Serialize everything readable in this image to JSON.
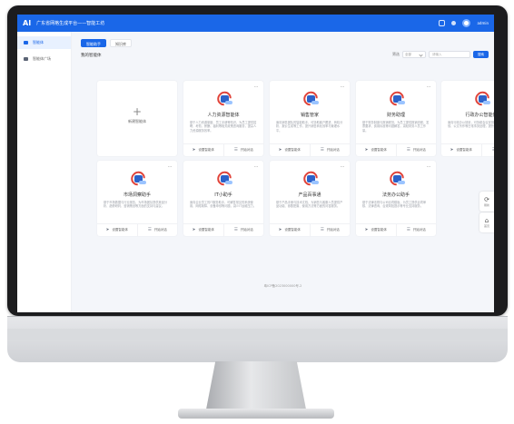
{
  "header": {
    "logo": "AI",
    "title": "广东省网格生成平台——智能工坊",
    "user": "admin"
  },
  "sidebar": {
    "items": [
      {
        "label": "智能体",
        "active": true
      },
      {
        "label": "智能体广场",
        "active": false
      }
    ]
  },
  "main": {
    "tabs": [
      {
        "label": "智能助手",
        "active": true
      },
      {
        "label": "知识库",
        "active": false
      }
    ],
    "section_title": "我的智能体",
    "filter_label": "筛选",
    "filter_value": "全部",
    "search_placeholder": "请输入",
    "search_button": "搜索",
    "new_card_label": "新建智能体",
    "footer_text": "粤ICP备2023000000号-2"
  },
  "cards": [
    {
      "name": "人力资源智能体",
      "desc": "基于人力资源制度、员工手册等知识，为员工提供招聘、考勤、薪酬、福利等相关政策咨询服务，提高人力资源服务效率。",
      "action1": "设置智能体",
      "action2": "开始对话"
    },
    {
      "name": "销售管家",
      "desc": "面向销售团队的智能助手，可协助客户跟进、商机分析、报价生成等工作，提升销售转化效率与管理水平。",
      "action1": "设置智能体",
      "action2": "开始对话"
    },
    {
      "name": "财务助理",
      "desc": "基于财务制度与报销规范，为员工提供报销流程、发票要求、费用标准等问题解答，减轻财务人员工作量。",
      "action1": "设置智能体",
      "action2": "开始对话"
    },
    {
      "name": "行政办公智能体",
      "desc": "面向行政办公场景，可协助会议安排、办公用品申领、公文写作等日常事务处理，提升办公效率。",
      "action1": "设置智能体",
      "action2": "开始对话"
    },
    {
      "name": "市场洞察助手",
      "desc": "基于市场数据与行业报告，为市场团队提供竞品分析、趋势研判、营销策划等方面的支持与建议。",
      "action1": "设置智能体",
      "action2": "开始对话"
    },
    {
      "name": "IT小助手",
      "desc": "面向企业员工的IT服务助手，可解答常见的系统使用、网络故障、设备申领等问题，减少IT运维压力。",
      "action1": "设置智能体",
      "action2": "开始对话"
    },
    {
      "name": "产品百事通",
      "desc": "基于产品手册与技术文档，为销售与客服人员提供产品功能、参数配置、使用方法等方面的问答服务。",
      "action1": "设置智能体",
      "action2": "开始对话"
    },
    {
      "name": "法务办公助手",
      "desc": "基于法律法规与公司合同模板，为员工提供合同审核、法律咨询、合规风险提示等专业支持服务。",
      "action1": "设置智能体",
      "action2": "开始对话"
    }
  ],
  "float_buttons": [
    {
      "icon": "refresh-icon",
      "label": "刷新"
    },
    {
      "icon": "home-icon",
      "label": "首页"
    }
  ],
  "colors": {
    "primary": "#1a67e8",
    "background": "#f4f6fa",
    "bezel": "#1c1c1e"
  }
}
